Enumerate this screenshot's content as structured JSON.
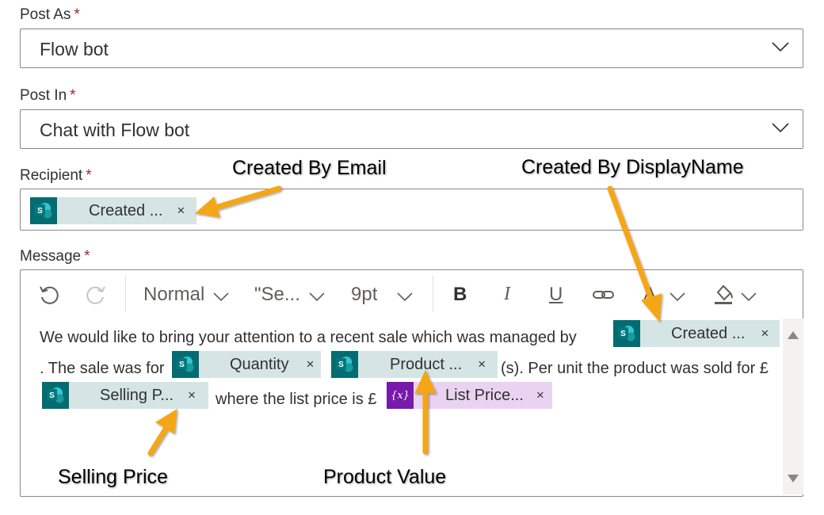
{
  "post_as": {
    "label": "Post As",
    "required": "*",
    "value": "Flow bot"
  },
  "post_in": {
    "label": "Post In",
    "required": "*",
    "value": "Chat with Flow bot"
  },
  "recipient": {
    "label": "Recipient",
    "required": "*",
    "token": {
      "text": "Created ...",
      "remove": "×"
    }
  },
  "message": {
    "label": "Message",
    "required": "*",
    "toolbar": {
      "style": "Normal",
      "font": "\"Se...",
      "size": "9pt",
      "bold": "B",
      "italic": "I",
      "underline": "U",
      "font_color": "A"
    },
    "line1_text": "We would like to bring your attention to a recent sale which was managed by",
    "token_created": {
      "text": "Created ...",
      "remove": "×"
    },
    "line2_prefix": ". The sale was for",
    "token_quantity": {
      "text": "Quantity",
      "remove": "×"
    },
    "token_product": {
      "text": "Product ...",
      "remove": "×"
    },
    "line2_suffix": "(s). Per unit the product was sold for £",
    "token_selling": {
      "text": "Selling P...",
      "remove": "×"
    },
    "line3_middle": "where the list price is £",
    "token_list_price": {
      "icon": "{x}",
      "text": "List Price...",
      "remove": "×"
    }
  },
  "callouts": {
    "created_by_email": "Created By Email",
    "created_by_displayname": "Created By DisplayName",
    "selling_price": "Selling Price",
    "product_value": "Product Value"
  },
  "colors": {
    "sharepoint_icon": "#036c70",
    "token_bg": "#d5e5e5",
    "variable_icon": "#7719aa",
    "variable_bg": "#ead3f2",
    "arrow": "#f5a614",
    "required": "#a4262c"
  },
  "icons": {
    "dropdown": "chevron-down-icon",
    "token": "sharepoint-icon",
    "variable": "variable-icon",
    "undo": "undo-icon",
    "redo": "redo-icon",
    "link": "link-icon",
    "highlight": "paint-bucket-icon"
  }
}
